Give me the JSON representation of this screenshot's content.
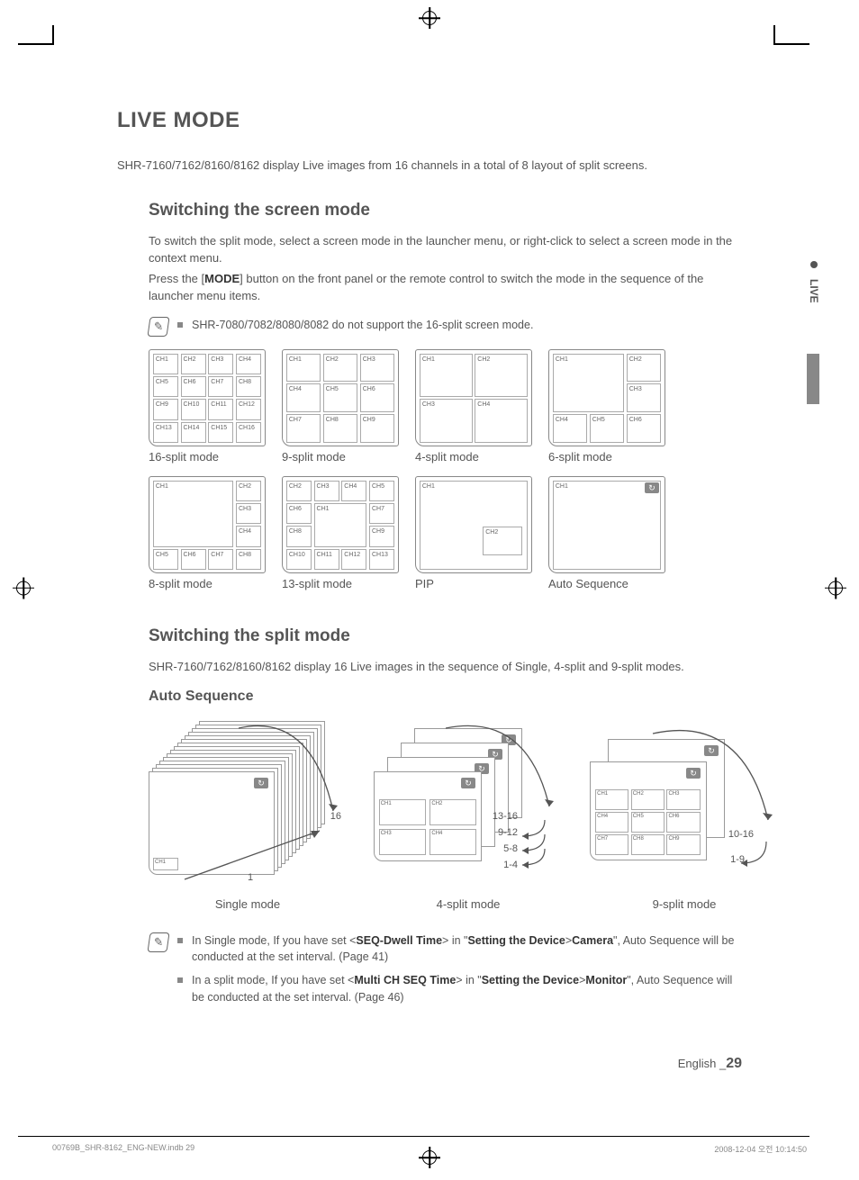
{
  "heading": "LIVE MODE",
  "intro": "SHR-7160/7162/8160/8162 display Live images from 16 channels in a total of 8 layout of split screens.",
  "section1": {
    "title": "Switching the screen mode",
    "p1": "To switch the split mode, select a screen mode in the launcher menu, or right-click to select a screen mode in the context menu.",
    "p2_pre": "Press the [",
    "p2_bold": "MODE",
    "p2_post": "] button on the front panel or the remote control to switch the mode in the sequence of the launcher menu items."
  },
  "note1": "SHR-7080/7082/8080/8082 do not support the 16-split screen mode.",
  "modes": {
    "m16": "16-split mode",
    "m9": "9-split mode",
    "m4": "4-split mode",
    "m6": "6-split mode",
    "m8": "8-split mode",
    "m13": "13-split mode",
    "pip": "PIP",
    "auto": "Auto Sequence"
  },
  "ch": {
    "c1": "CH1",
    "c2": "CH2",
    "c3": "CH3",
    "c4": "CH4",
    "c5": "CH5",
    "c6": "CH6",
    "c7": "CH7",
    "c8": "CH8",
    "c9": "CH9",
    "c10": "CH10",
    "c11": "CH11",
    "c12": "CH12",
    "c13": "CH13",
    "c14": "CH14",
    "c15": "CH15",
    "c16": "CH16"
  },
  "section2": {
    "title": "Switching the split mode",
    "p1": "SHR-7160/7162/8160/8162 display 16 Live images in the sequence of Single, 4-split and 9-split modes."
  },
  "section3": {
    "title": "Auto Sequence",
    "single": "Single mode",
    "four": "4-split mode",
    "nine": "9-split mode",
    "n1": "1",
    "n16": "16",
    "r1": "1-4",
    "r2": "5-8",
    "r3": "9-12",
    "r4": "13-16",
    "r5": "1-9",
    "r6": "10-16"
  },
  "note2a_pre": "In Single mode, If you have set <",
  "note2a_b1": "SEQ-Dwell Time",
  "note2a_mid": "> in \"",
  "note2a_b2": "Setting the Device",
  "note2a_mid2": ">",
  "note2a_b3": "Camera",
  "note2a_post": "\", Auto Sequence will be conducted at the set interval. (Page 41)",
  "note2b_pre": "In a split mode, If you have set <",
  "note2b_b1": "Multi CH SEQ Time",
  "note2b_mid": "> in \"",
  "note2b_b2": "Setting the Device",
  "note2b_mid2": ">",
  "note2b_b3": "Monitor",
  "note2b_post": "\", Auto Sequence will be conducted at the set interval. (Page 46)",
  "sidetab": "LIVE",
  "footer_lang": "English _",
  "footer_page": "29",
  "print_left": "00769B_SHR-8162_ENG-NEW.indb   29",
  "print_right": "2008-12-04   오전 10:14:50"
}
